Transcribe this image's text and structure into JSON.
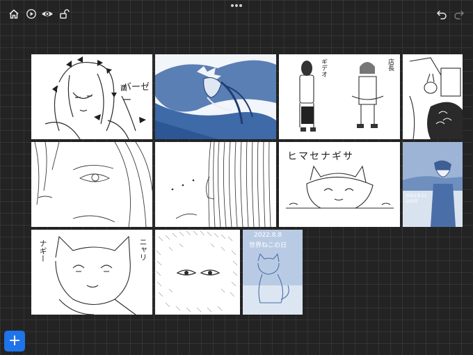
{
  "toolbar": {
    "left_icons": [
      "home-icon",
      "play-icon",
      "eye-icon",
      "unlock-icon"
    ],
    "right_icons": [
      "undo-icon",
      "redo-icon"
    ]
  },
  "gallery": {
    "artworks": [
      {
        "title": "バーゼー"
      },
      {
        "title": ""
      },
      {
        "title": "ギデオ"
      },
      {
        "title": ""
      },
      {
        "title": ""
      },
      {
        "title": ""
      },
      {
        "title": "ヒマセナギサ"
      },
      {
        "title": "2022.8.11"
      },
      {
        "title": "ナギー"
      },
      {
        "title": ""
      },
      {
        "title": "2022.8.8 世界ねこの日"
      }
    ],
    "thumb_texts": {
      "t1": "バーゼー",
      "t3a": "ギデオ",
      "t3b": "店長",
      "t7": "ヒマセナギサ",
      "t8": "2022.8.11 山の日",
      "t9a": "ナギー",
      "t9b": "ニャリ",
      "t11a": "2022.8.8",
      "t11b": "世界ねこの日"
    }
  },
  "add_button": {
    "label": "+"
  },
  "colors": {
    "background": "#232323",
    "accent": "#1e74e8",
    "blue_ink": "#4a6fa8"
  }
}
